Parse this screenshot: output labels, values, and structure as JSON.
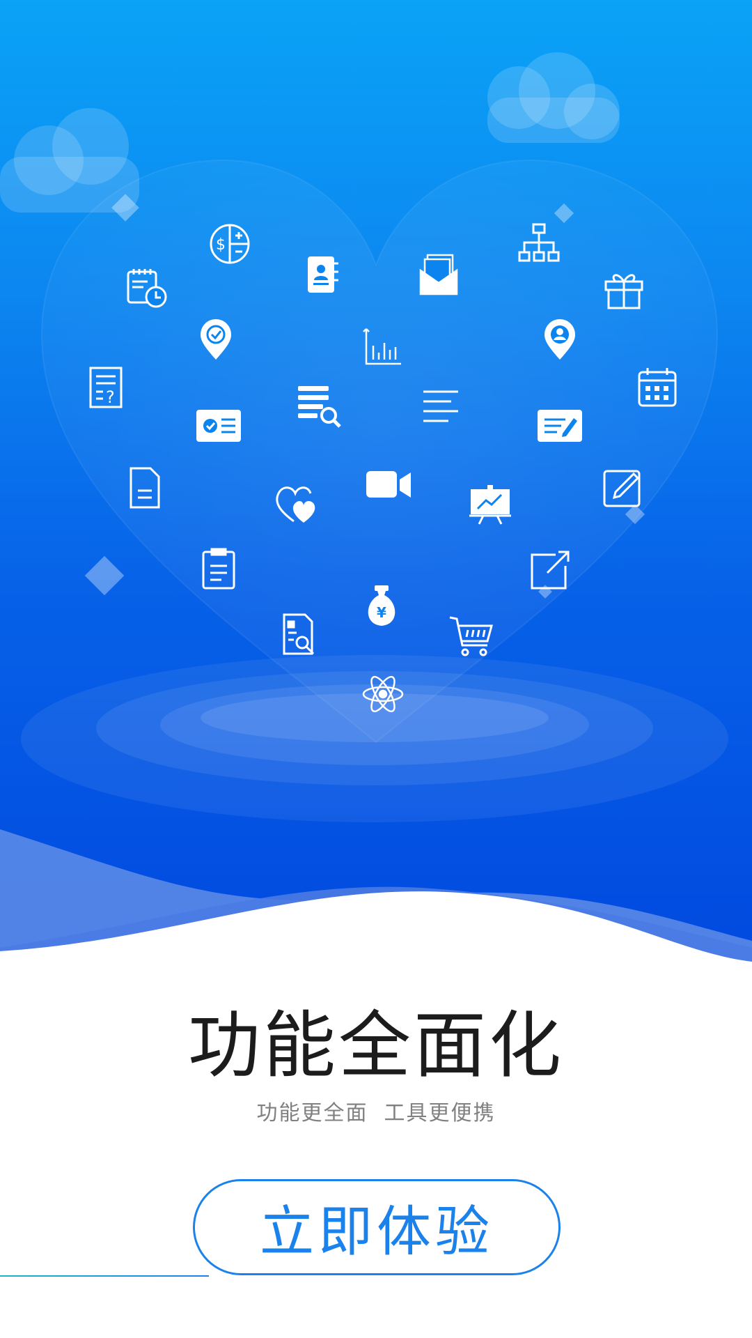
{
  "onboarding": {
    "title": "功能全面化",
    "subtitle": "功能更全面  工具更便携",
    "cta_label": "立即体验"
  },
  "colors": {
    "sky_top": "#0aa3f7",
    "sky_bottom": "#0148df",
    "accent": "#1b82ec",
    "title_text": "#1c1c1c",
    "subtitle_text": "#808080"
  },
  "icons": [
    "calendar-clock-icon",
    "dollar-calculator-icon",
    "contact-book-icon",
    "mail-documents-icon",
    "org-chart-icon",
    "gift-icon",
    "location-check-icon",
    "bar-chart-icon",
    "location-user-icon",
    "document-question-icon",
    "id-card-icon",
    "list-search-icon",
    "text-lines-icon",
    "edit-card-icon",
    "calendar-grid-icon",
    "document-icon",
    "heart-icon",
    "video-camera-icon",
    "presentation-chart-icon",
    "edit-square-icon",
    "clipboard-icon",
    "external-link-icon",
    "money-bag-icon",
    "document-search-icon",
    "shopping-cart-icon",
    "atom-icon"
  ]
}
